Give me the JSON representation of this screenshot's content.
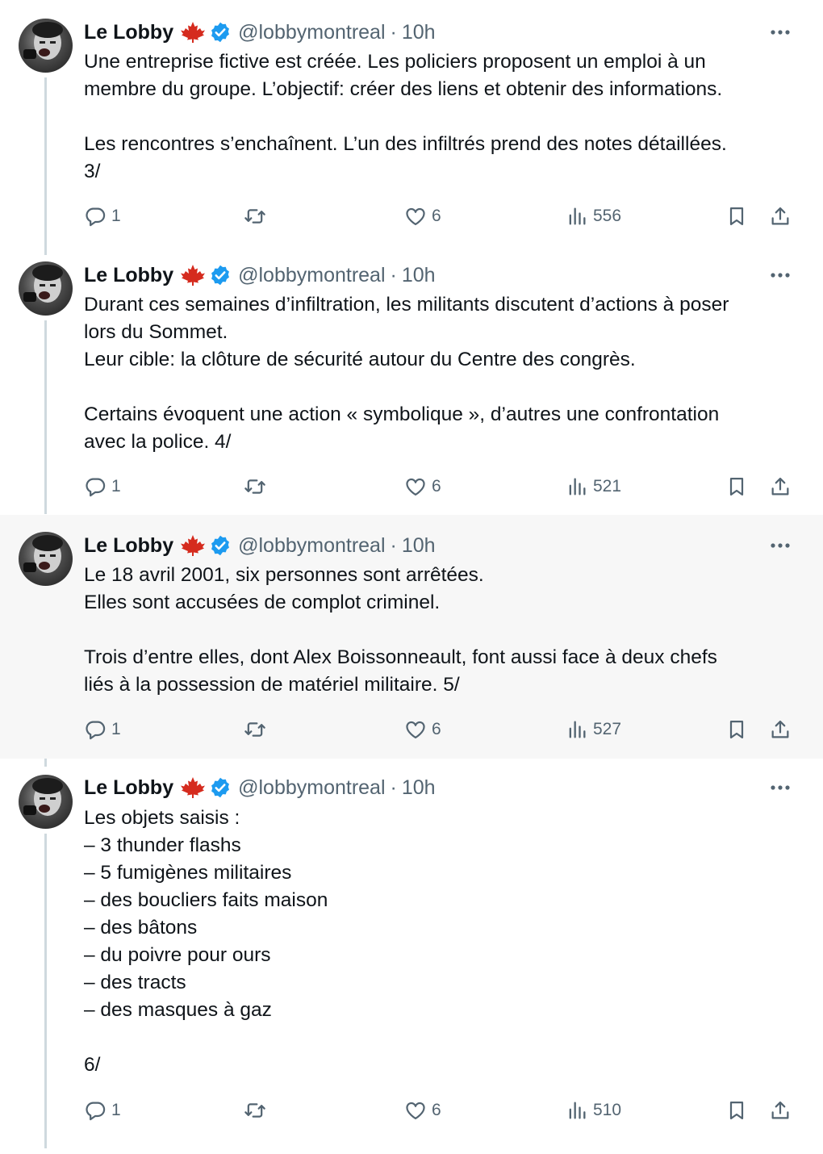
{
  "tweets": [
    {
      "author": "Le Lobby",
      "handle": "@lobbymontreal",
      "separator": "·",
      "time": "10h",
      "text": "Une entreprise fictive est créée. Les policiers proposent un emploi à un\nmembre du groupe. L’objectif: créer des liens et obtenir des informations.\n\nLes rencontres s’enchaînent. L’un des infiltrés prend des notes détaillées.\n3/",
      "replies": "1",
      "reposts": "",
      "likes": "6",
      "views": "556"
    },
    {
      "author": "Le Lobby",
      "handle": "@lobbymontreal",
      "separator": "·",
      "time": "10h",
      "text": "Durant ces semaines d’infiltration, les militants discutent d’actions à poser\nlors du Sommet.\nLeur cible: la clôture de sécurité autour du Centre des congrès.\n\nCertains évoquent une action « symbolique », d’autres une confrontation\navec la police. 4/",
      "replies": "1",
      "reposts": "",
      "likes": "6",
      "views": "521"
    },
    {
      "author": "Le Lobby",
      "handle": "@lobbymontreal",
      "separator": "·",
      "time": "10h",
      "text": "Le 18 avril 2001, six personnes sont arrêtées.\nElles sont accusées de complot criminel.\n\nTrois d’entre elles, dont Alex Boissonneault, font aussi face à deux chefs\nliés à la possession de matériel militaire. 5/",
      "replies": "1",
      "reposts": "",
      "likes": "6",
      "views": "527"
    },
    {
      "author": "Le Lobby",
      "handle": "@lobbymontreal",
      "separator": "·",
      "time": "10h",
      "text": "Les objets saisis :\n– 3 thunder flashs\n– 5 fumigènes militaires\n– des boucliers faits maison\n– des bâtons\n– du poivre pour ours\n– des tracts\n– des masques à gaz\n\n6/",
      "replies": "1",
      "reposts": "",
      "likes": "6",
      "views": "510"
    }
  ],
  "icons": {
    "flag": "maple-leaf-icon",
    "verified": "verified-badge-icon",
    "more": "more-icon",
    "reply": "reply-icon",
    "repost": "repost-icon",
    "like": "heart-icon",
    "views": "views-icon",
    "bookmark": "bookmark-icon",
    "share": "share-icon"
  },
  "colors": {
    "text": "#0f1419",
    "secondary": "#536471",
    "verified": "#1d9bf0",
    "maple": "#d52b1e",
    "highlight_bg": "#f7f7f7",
    "thread_line": "#cfd9de"
  }
}
